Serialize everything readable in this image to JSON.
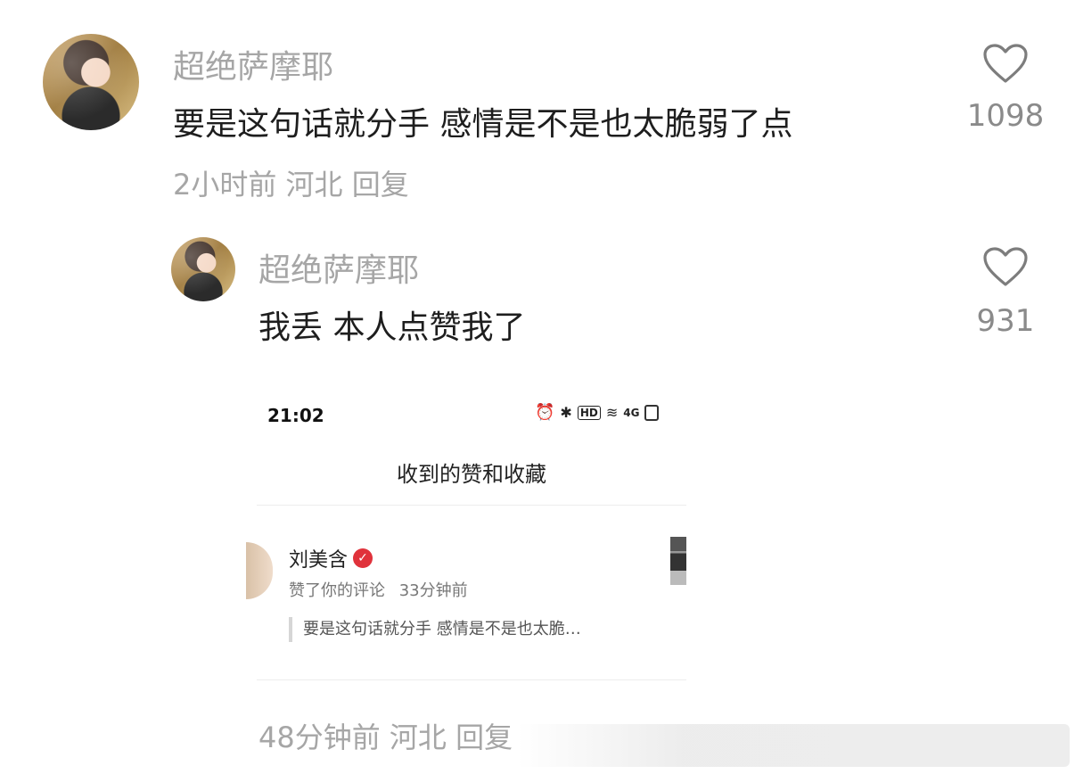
{
  "comments": [
    {
      "username": "超绝萨摩耶",
      "text": "要是这句话就分手 感情是不是也太脆弱了点",
      "likes": "1098",
      "meta": "2小时前 河北 回复"
    },
    {
      "username": "超绝萨摩耶",
      "text": "我丢 本人点赞我了",
      "likes": "931",
      "meta": "48分钟前 河北 回复"
    }
  ],
  "screenshot": {
    "time": "21:02",
    "title": "收到的赞和收藏",
    "user_name": "刘美含",
    "action": "赞了你的评论",
    "action_time": "33分钟前",
    "quote": "要是这句话就分手 感情是不是也太脆…"
  },
  "icons": {
    "heart": "heart-icon",
    "alarm": "alarm-icon",
    "bluetooth": "bluetooth-icon",
    "hd": "HD",
    "wifi": "wifi-icon",
    "network": "4G",
    "battery": "battery-icon",
    "verified": "verified-icon"
  },
  "colors": {
    "username": "#a6a6a6",
    "verified": "#e0323b"
  }
}
